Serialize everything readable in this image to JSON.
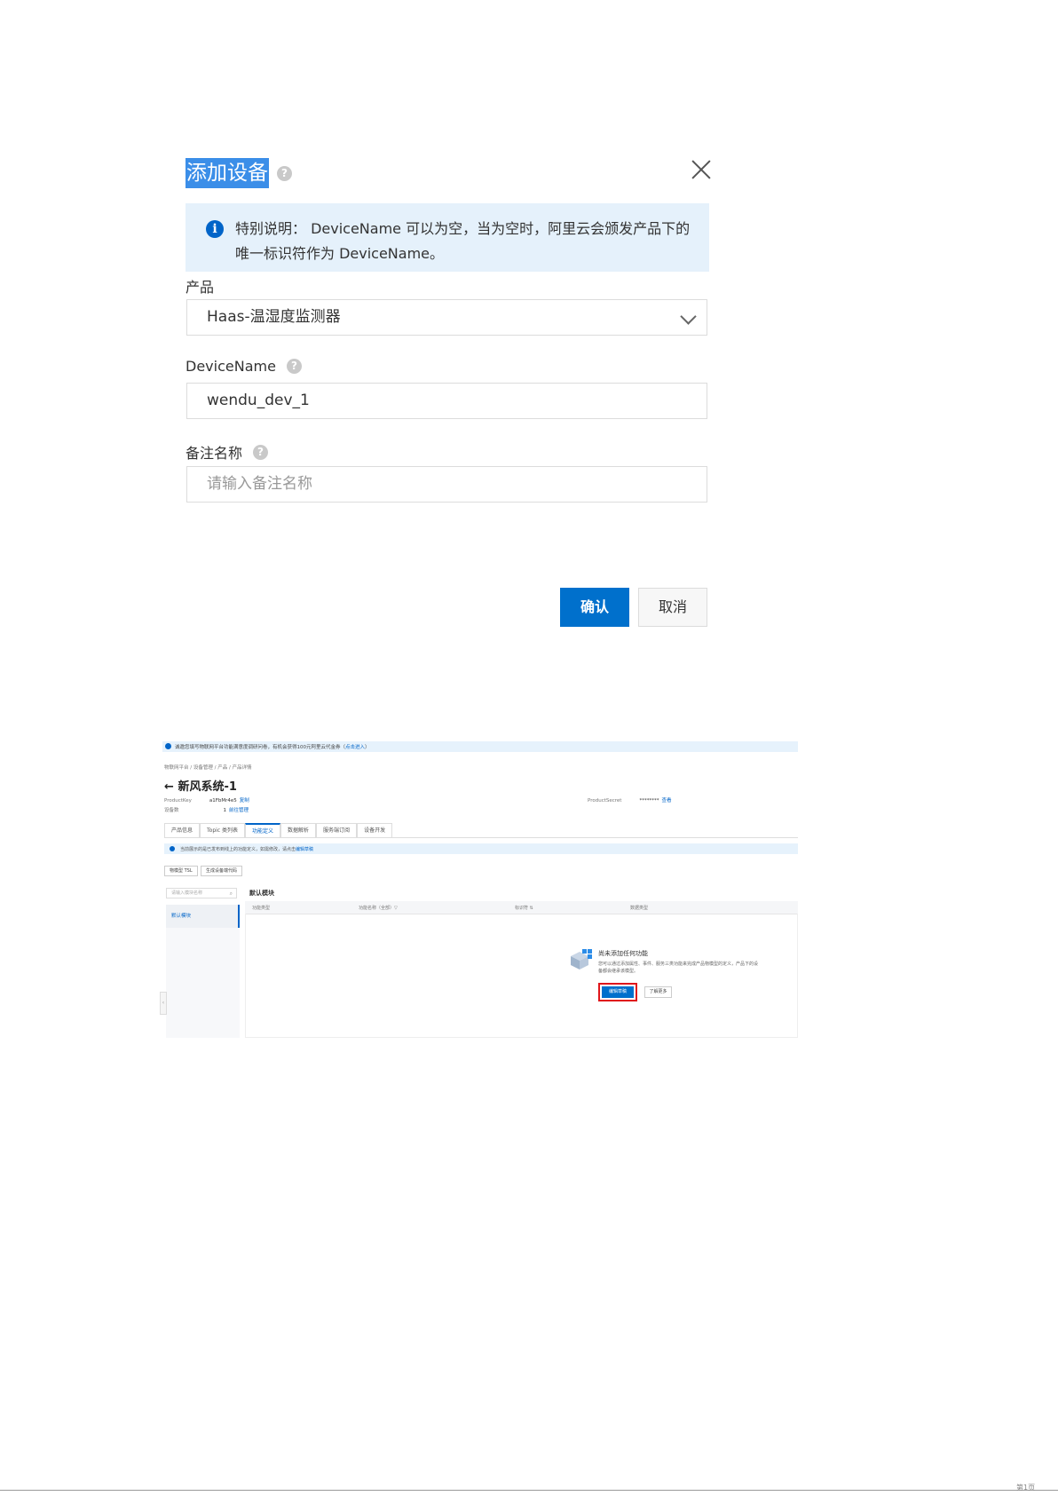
{
  "dialog": {
    "title": "添加设备",
    "notice": "特别说明： DeviceName 可以为空，当为空时，阿里云会颁发产品下的唯一标识符作为 DeviceName。",
    "product_label": "产品",
    "product_value": "Haas-温湿度监测器",
    "devicename_label": "DeviceName",
    "devicename_value": "wendu_dev_1",
    "remark_label": "备注名称",
    "remark_placeholder": "请输入备注名称",
    "confirm": "确认",
    "cancel": "取消"
  },
  "console": {
    "banner_text": "诚邀您填写物联网平台功能满意度调研问卷，有机会获得100元阿里云代金券（",
    "banner_link": "点击进入",
    "banner_end": "）",
    "breadcrumb": "物联网平台  /  设备管理  /  产品  /  产品详情",
    "title": "新风系统-1",
    "product_key_label": "ProductKey",
    "product_key_value": "a1FbMr4e5",
    "product_key_action": "复制",
    "device_count_label": "设备数",
    "device_count_value": "1",
    "device_count_action": "前往管理",
    "product_secret_label": "ProductSecret",
    "product_secret_value": "********",
    "product_secret_action": "查看",
    "tabs": [
      "产品信息",
      "Topic 类列表",
      "功能定义",
      "数据解析",
      "服务端订阅",
      "设备开发"
    ],
    "info_text": "当前展示的是已发布到线上的功能定义，如需修改，请点击",
    "info_link": "编辑草稿",
    "btn_tsl": "物模型 TSL",
    "btn_gen": "生成设备端代码",
    "search_placeholder": "请输入模块名称",
    "side_selected": "默认模块",
    "module_title": "默认模块",
    "columns": [
      "功能类型",
      "功能名称（全部）▽",
      "标识符 ⇅",
      "数据类型"
    ],
    "empty_title": "尚未添加任何功能",
    "empty_desc": "您可以通过添加属性、事件、服务三类功能来完成产品物模型的定义，产品下的设备都会继承该模型。",
    "edit_draft": "编辑草稿",
    "learn_more": "了解更多"
  },
  "footer": {
    "text": "第1页"
  }
}
